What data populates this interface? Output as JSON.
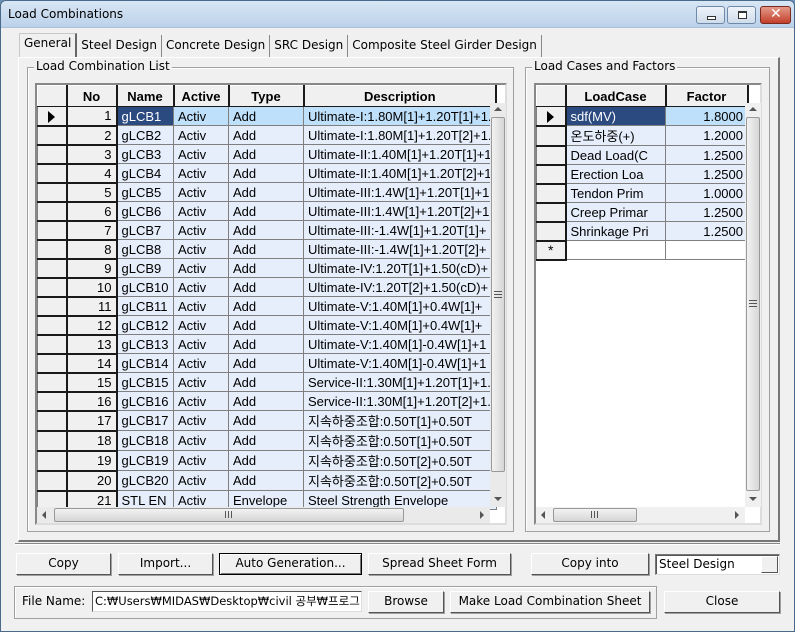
{
  "window": {
    "title": "Load Combinations",
    "controls": {
      "minimize": "minimize-icon",
      "maximize": "maximize-icon",
      "close": "close-icon"
    }
  },
  "tabs": [
    {
      "label": "General",
      "active": true
    },
    {
      "label": "Steel Design",
      "active": false
    },
    {
      "label": "Concrete Design",
      "active": false
    },
    {
      "label": "SRC Design",
      "active": false
    },
    {
      "label": "Composite Steel Girder Design",
      "active": false
    }
  ],
  "combination_list": {
    "group_label": "Load Combination List",
    "columns": [
      "No",
      "Name",
      "Active",
      "Type",
      "Description"
    ],
    "rows": [
      {
        "no": "1",
        "name": "gLCB1",
        "active": "Activ",
        "type": "Add",
        "description": "Ultimate-I:1.80M[1]+1.20T[1]+1.",
        "current": true
      },
      {
        "no": "2",
        "name": "gLCB2",
        "active": "Activ",
        "type": "Add",
        "description": "Ultimate-I:1.80M[1]+1.20T[2]+1."
      },
      {
        "no": "3",
        "name": "gLCB3",
        "active": "Activ",
        "type": "Add",
        "description": "Ultimate-II:1.40M[1]+1.20T[1]+1"
      },
      {
        "no": "4",
        "name": "gLCB4",
        "active": "Activ",
        "type": "Add",
        "description": "Ultimate-II:1.40M[1]+1.20T[2]+1"
      },
      {
        "no": "5",
        "name": "gLCB5",
        "active": "Activ",
        "type": "Add",
        "description": "Ultimate-III:1.4W[1]+1.20T[1]+1"
      },
      {
        "no": "6",
        "name": "gLCB6",
        "active": "Activ",
        "type": "Add",
        "description": "Ultimate-III:1.4W[1]+1.20T[2]+1"
      },
      {
        "no": "7",
        "name": "gLCB7",
        "active": "Activ",
        "type": "Add",
        "description": "Ultimate-III:-1.4W[1]+1.20T[1]+"
      },
      {
        "no": "8",
        "name": "gLCB8",
        "active": "Activ",
        "type": "Add",
        "description": "Ultimate-III:-1.4W[1]+1.20T[2]+"
      },
      {
        "no": "9",
        "name": "gLCB9",
        "active": "Activ",
        "type": "Add",
        "description": "Ultimate-IV:1.20T[1]+1.50(cD)+"
      },
      {
        "no": "10",
        "name": "gLCB10",
        "active": "Activ",
        "type": "Add",
        "description": "Ultimate-IV:1.20T[2]+1.50(cD)+"
      },
      {
        "no": "11",
        "name": "gLCB11",
        "active": "Activ",
        "type": "Add",
        "description": "Ultimate-V:1.40M[1]+0.4W[1]+"
      },
      {
        "no": "12",
        "name": "gLCB12",
        "active": "Activ",
        "type": "Add",
        "description": "Ultimate-V:1.40M[1]+0.4W[1]+"
      },
      {
        "no": "13",
        "name": "gLCB13",
        "active": "Activ",
        "type": "Add",
        "description": "Ultimate-V:1.40M[1]-0.4W[1]+1"
      },
      {
        "no": "14",
        "name": "gLCB14",
        "active": "Activ",
        "type": "Add",
        "description": "Ultimate-V:1.40M[1]-0.4W[1]+1"
      },
      {
        "no": "15",
        "name": "gLCB15",
        "active": "Activ",
        "type": "Add",
        "description": "Service-II:1.30M[1]+1.20T[1]+1."
      },
      {
        "no": "16",
        "name": "gLCB16",
        "active": "Activ",
        "type": "Add",
        "description": "Service-II:1.30M[1]+1.20T[2]+1."
      },
      {
        "no": "17",
        "name": "gLCB17",
        "active": "Activ",
        "type": "Add",
        "description": "지속하중조합:0.50T[1]+0.50T"
      },
      {
        "no": "18",
        "name": "gLCB18",
        "active": "Activ",
        "type": "Add",
        "description": "지속하중조합:0.50T[1]+0.50T"
      },
      {
        "no": "19",
        "name": "gLCB19",
        "active": "Activ",
        "type": "Add",
        "description": "지속하중조합:0.50T[2]+0.50T"
      },
      {
        "no": "20",
        "name": "gLCB20",
        "active": "Activ",
        "type": "Add",
        "description": "지속하중조합:0.50T[2]+0.50T"
      },
      {
        "no": "21",
        "name": "STL EN",
        "active": "Activ",
        "type": "Envelope",
        "description": "Steel Strength Envelope"
      }
    ]
  },
  "load_cases": {
    "group_label": "Load Cases and Factors",
    "columns": [
      "LoadCase",
      "Factor"
    ],
    "rows": [
      {
        "loadcase": "sdf(MV)",
        "factor": "1.8000",
        "current": true
      },
      {
        "loadcase": "온도하중(+)",
        "factor": "1.2000"
      },
      {
        "loadcase": "Dead Load(C",
        "factor": "1.2500"
      },
      {
        "loadcase": "Erection Loa",
        "factor": "1.2500"
      },
      {
        "loadcase": "Tendon Prim",
        "factor": "1.0000"
      },
      {
        "loadcase": "Creep Primar",
        "factor": "1.2500"
      },
      {
        "loadcase": "Shrinkage Pri",
        "factor": "1.2500"
      }
    ],
    "new_row_marker": "*"
  },
  "buttons": {
    "copy": "Copy",
    "import": "Import...",
    "auto_generation": "Auto Generation...",
    "spread_sheet_form": "Spread Sheet Form",
    "copy_into": "Copy into",
    "copy_into_target": "Steel Design",
    "browse": "Browse",
    "make_sheet": "Make Load Combination Sheet",
    "close": "Close"
  },
  "file": {
    "label": "File Name:",
    "value": "C:₩Users₩MIDAS₩Desktop₩civil 공부₩프로그"
  },
  "colors": {
    "selected_cell": "#2a4a80",
    "current_row": "#bfe0fb",
    "cell_bg": "#e5eefa",
    "dialog_bg": "#f0f0f0"
  }
}
